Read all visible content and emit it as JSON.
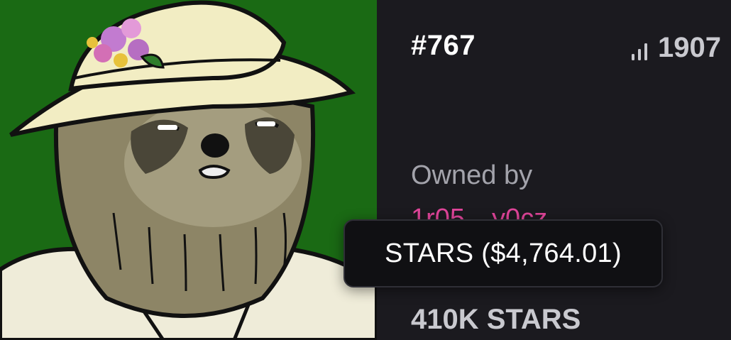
{
  "nft": {
    "token_id": "#767",
    "rank": "1907",
    "rank_icon": "signal-bars-icon",
    "image_description_icon": "sloth-artwork"
  },
  "ownership": {
    "owned_by_label": "Owned by",
    "owner_address": "1r05…y0cz"
  },
  "price": {
    "amount": "410K STARS",
    "tooltip": "STARS ($4,764.01)"
  },
  "colors": {
    "background": "#1b1a1f",
    "art_background": "#1a6a14",
    "owner_link": "#e0459a",
    "muted_text": "#a3a3ab",
    "tooltip_bg": "#101013"
  }
}
